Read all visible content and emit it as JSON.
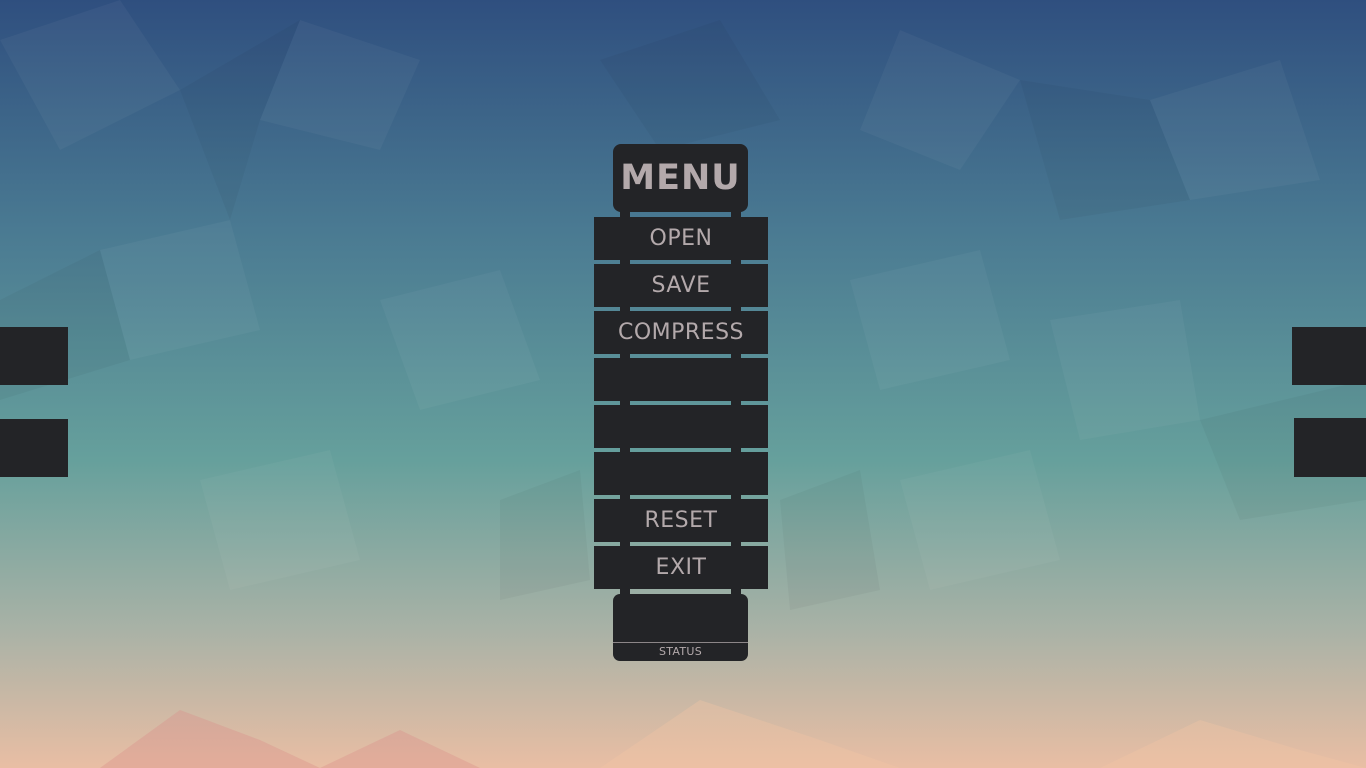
{
  "colors": {
    "panel": "#232427",
    "text": "#b3a9ab",
    "bg_top": "#2f4f7f",
    "bg_mid": "#66a09c",
    "bg_bottom": "#e9bea4"
  },
  "menu": {
    "title": "MENU",
    "items": [
      {
        "label": "OPEN"
      },
      {
        "label": "SAVE"
      },
      {
        "label": "COMPRESS"
      },
      {
        "label": ""
      },
      {
        "label": ""
      },
      {
        "label": ""
      },
      {
        "label": "RESET"
      },
      {
        "label": "EXIT"
      }
    ]
  },
  "status": {
    "label": "STATUS",
    "value": ""
  }
}
